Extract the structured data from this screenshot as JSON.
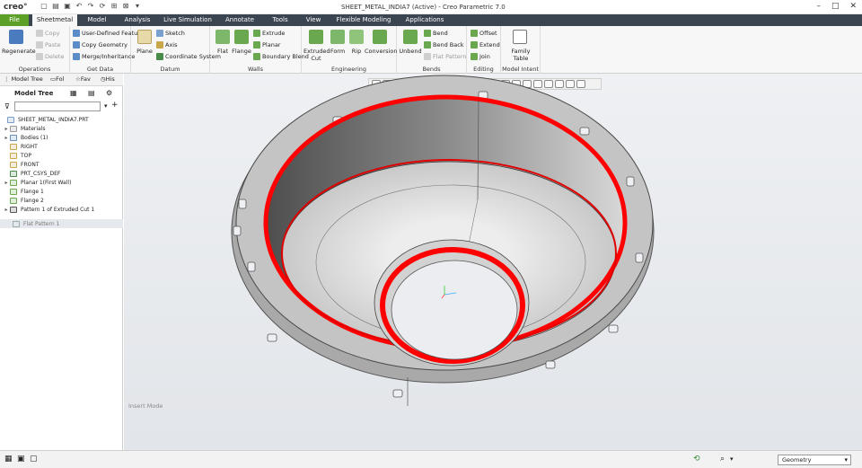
{
  "app": {
    "logo": "creo°",
    "window_title": "SHEET_METAL_INDIA7 (Active) - Creo Parametric 7.0"
  },
  "tabs": [
    "File",
    "Sheetmetal",
    "Model",
    "Analysis",
    "Live Simulation",
    "Annotate",
    "Tools",
    "View",
    "Flexible Modeling",
    "Applications"
  ],
  "ribbon": {
    "operations": {
      "label": "Operations",
      "regenerate": "Regenerate",
      "copy": "Copy",
      "paste": "Paste",
      "delete": "Delete"
    },
    "get_data": {
      "label": "Get Data",
      "udf": "User-Defined Feature",
      "copy_geometry": "Copy Geometry",
      "merge": "Merge/Inheritance"
    },
    "datum": {
      "label": "Datum",
      "plane": "Plane",
      "sketch": "Sketch",
      "axis": "Axis",
      "csys": "Coordinate System"
    },
    "walls": {
      "label": "Walls",
      "flat": "Flat",
      "flange": "Flange",
      "extrude": "Extrude",
      "planar": "Planar",
      "boundary_blend": "Boundary Blend"
    },
    "engineering": {
      "label": "Engineering",
      "extruded_cut": "Extruded",
      "extruded_cut2": "Cut",
      "form": "Form",
      "rip": "Rip",
      "conversion": "Conversion"
    },
    "bends": {
      "label": "Bends",
      "unbend": "Unbend",
      "bend": "Bend",
      "bend_back": "Bend Back",
      "flat_pattern": "Flat Pattern"
    },
    "editing": {
      "label": "Editing",
      "offset": "Offset",
      "extend": "Extend",
      "join": "Join"
    },
    "model_intent": {
      "label": "Model Intent",
      "family1": "Family",
      "family2": "Table"
    }
  },
  "panel": {
    "tabs": [
      "Model Tree",
      "Fol",
      "Fav",
      "His"
    ],
    "header": "Model Tree",
    "items": [
      {
        "label": "SHEET_METAL_INDIA7.PRT",
        "exp": "",
        "indent": 0,
        "color": "#7a9cc6"
      },
      {
        "label": "Materials",
        "exp": "▸",
        "indent": 1,
        "color": "#9a9a9a"
      },
      {
        "label": "Bodies (1)",
        "exp": "▸",
        "indent": 1,
        "color": "#6a8fbf"
      },
      {
        "label": "RIGHT",
        "exp": "",
        "indent": 1,
        "color": "#c9a64a"
      },
      {
        "label": "TOP",
        "exp": "",
        "indent": 1,
        "color": "#c9a64a"
      },
      {
        "label": "FRONT",
        "exp": "",
        "indent": 1,
        "color": "#c9a64a"
      },
      {
        "label": "PRT_CSYS_DEF",
        "exp": "",
        "indent": 1,
        "color": "#4a8a4a"
      },
      {
        "label": "Planar 1(First Wall)",
        "exp": "▸",
        "indent": 1,
        "color": "#6aa84f"
      },
      {
        "label": "Flange 1",
        "exp": "",
        "indent": 1,
        "color": "#6aa84f"
      },
      {
        "label": "Flange 2",
        "exp": "",
        "indent": 1,
        "color": "#6aa84f"
      },
      {
        "label": "Pattern 1 of Extruded Cut 1",
        "exp": "▸",
        "indent": 1,
        "color": "#555555"
      }
    ],
    "insert_item": "Flat Pattern 1"
  },
  "viewport": {
    "mode_text": "Insert Mode"
  },
  "status": {
    "selection_filter": "Geometry"
  },
  "colors": {
    "tabbar": "#3b4451",
    "file_tab": "#5ca028",
    "highlight": "#ff0000",
    "part": "#b8b8b8"
  }
}
